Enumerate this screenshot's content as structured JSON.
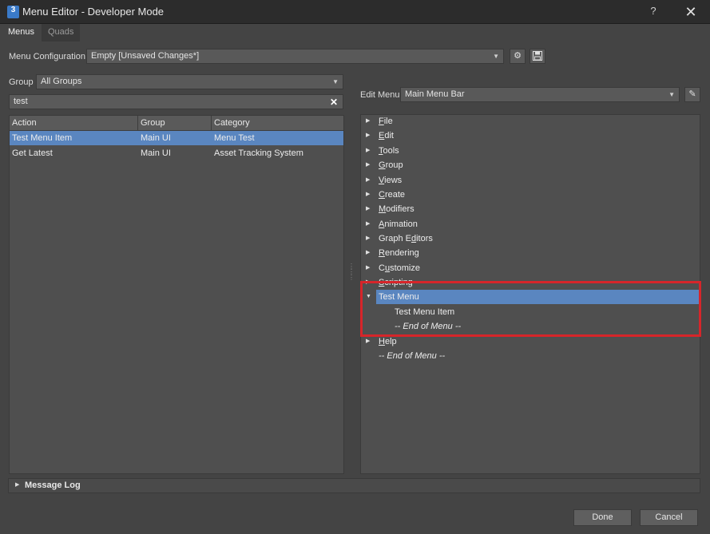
{
  "window": {
    "title": "Menu Editor - Developer Mode",
    "app_icon_text": "3",
    "help": "?",
    "close": "✕"
  },
  "tabs": [
    {
      "label": "Menus"
    },
    {
      "label": "Quads"
    }
  ],
  "config": {
    "label": "Menu Configuration",
    "value": "Empty [Unsaved Changes*]"
  },
  "left": {
    "group_label": "Group",
    "group_value": "All Groups",
    "search_value": "test",
    "columns": [
      "Action",
      "Group",
      "Category"
    ],
    "rows": [
      {
        "action": "Test Menu Item",
        "group": "Main UI",
        "category": "Menu Test",
        "selected": true
      },
      {
        "action": "Get Latest",
        "group": "Main UI",
        "category": "Asset Tracking System",
        "selected": false
      }
    ]
  },
  "right": {
    "edit_menu_label": "Edit Menu",
    "edit_menu_value": "Main Menu Bar",
    "tree": [
      {
        "pre": "",
        "u": "F",
        "post": "ile"
      },
      {
        "pre": "",
        "u": "E",
        "post": "dit"
      },
      {
        "pre": "",
        "u": "T",
        "post": "ools"
      },
      {
        "pre": "",
        "u": "G",
        "post": "roup"
      },
      {
        "pre": "",
        "u": "V",
        "post": "iews"
      },
      {
        "pre": "",
        "u": "C",
        "post": "reate"
      },
      {
        "pre": "",
        "u": "M",
        "post": "odifiers"
      },
      {
        "pre": "",
        "u": "A",
        "post": "nimation"
      },
      {
        "pre": "Graph E",
        "u": "d",
        "post": "itors"
      },
      {
        "pre": "",
        "u": "R",
        "post": "endering"
      },
      {
        "pre": "C",
        "u": "u",
        "post": "stomize"
      },
      {
        "pre": "",
        "u": "S",
        "post": "cripting"
      }
    ],
    "expanded": {
      "label": "Test Menu",
      "child": "Test Menu Item",
      "end": "-- End of Menu --"
    },
    "help": {
      "pre": "",
      "u": "H",
      "post": "elp"
    },
    "end": "-- End of Menu --"
  },
  "message_log": "Message Log",
  "buttons": {
    "done": "Done",
    "cancel": "Cancel"
  },
  "colors": {
    "selection": "#5a86c0",
    "highlight": "#d6252a",
    "background": "#444444"
  }
}
